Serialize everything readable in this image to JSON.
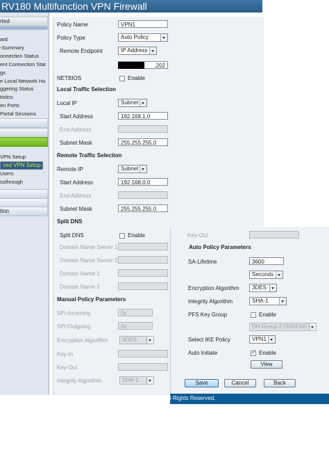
{
  "header": {
    "title": "RV180 Multifunction VPN Firewall"
  },
  "sidebar": {
    "section1_label": "rted",
    "status_items": [
      "ard",
      "-Summary",
      "onnection Status",
      "ent Connection Stat",
      "gs",
      "e Local Network Ho",
      "ggering Status",
      "tistics",
      "en Ports",
      "Portal Sessions"
    ],
    "nav_items": [
      "VPN Setup",
      "ced VPN Setup",
      "Users",
      "ssthrough"
    ],
    "section_bottom_label": "tion"
  },
  "form": {
    "policy_name": {
      "label": "Policy Name",
      "value": "VPN1"
    },
    "policy_type": {
      "label": "Policy Type",
      "value": "Auto Policy"
    },
    "remote_endpoint": {
      "label": "Remote Endpoint",
      "value": "IP Address",
      "ip_value": ".202"
    },
    "netbios": {
      "label": "NETBIOS",
      "check_label": "Enable"
    },
    "local": {
      "section": "Local Traffic Selection",
      "ip_label": "Local IP",
      "ip_value": "Subnet",
      "start_label": "Start Address",
      "start_value": "192.168.1.0",
      "end_label": "End Address",
      "end_value": "",
      "mask_label": "Subnet Mask",
      "mask_value": "255.255.255.0"
    },
    "remote": {
      "section": "Remote Traffic Selection",
      "ip_label": "Remote IP",
      "ip_value": "Subnet",
      "start_label": "Start Address",
      "start_value": "192.168.0.0",
      "end_label": "End Address",
      "end_value": "",
      "mask_label": "Subnet Mask",
      "mask_value": "255.255.255.0"
    },
    "split_dns": {
      "section": "Split DNS",
      "label": "Split DNS",
      "check_label": "Enable",
      "dns1": "Domain Name Server 1",
      "dns2": "Domain Name Server 2",
      "dn1": "Domain Name 1",
      "dn2": "Domain Name 2"
    },
    "manual": {
      "section": "Manual Policy Parameters",
      "spi_in_label": "SPI-Incoming",
      "spi_in_value": "0x",
      "spi_out_label": "SPI-Outgoing",
      "spi_out_value": "0x",
      "enc_label": "Encryption Algorithm",
      "enc_value": "3DES",
      "key_in_label": "Key-In",
      "key_out_label": "Key-Out",
      "int_label": "Integrity Algorithm",
      "int_value": "SHA-1"
    }
  },
  "overlay": {
    "key_out_label": "Key-Out",
    "section": "Auto Policy Parameters",
    "sa_lifetime": {
      "label": "SA-Lifetime",
      "value": "3600",
      "unit": "Seconds"
    },
    "enc": {
      "label": "Encryption Algorithm",
      "value": "3DES"
    },
    "int": {
      "label": "Integrity Algorithm",
      "value": "SHA-1"
    },
    "pfs": {
      "label": "PFS Key Group",
      "check_label": "Enable",
      "group": "DH-Group 2 (1024 bit)"
    },
    "ike": {
      "label": "Select IKE Policy",
      "value": "VPN1"
    },
    "auto": {
      "label": "Auto Initiate",
      "check_label": "Enable",
      "checked": true
    },
    "view_button": "View",
    "buttons": {
      "save": "Save",
      "cancel": "Cancel",
      "back": "Back"
    },
    "footer": "l Rights Reserved."
  }
}
